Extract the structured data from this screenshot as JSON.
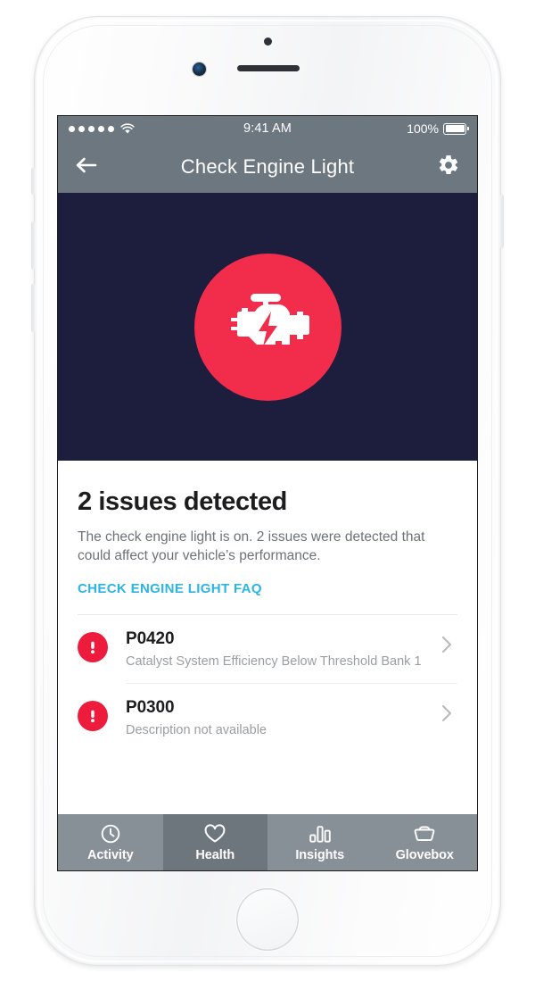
{
  "device": {
    "frame": "iphone-white",
    "hardware": {
      "camera": "front-camera",
      "speaker": "earpiece-speaker",
      "sensor": "proximity-sensor",
      "home_button": "home-button"
    }
  },
  "status_bar": {
    "signal_icon": "signal-dots-icon",
    "signal_bars_filled": 5,
    "wifi_icon": "wifi-icon",
    "time": "9:41 AM",
    "battery_percent": "100%",
    "battery_icon": "battery-full-icon"
  },
  "nav_bar": {
    "back_icon": "arrow-left-icon",
    "title": "Check Engine Light",
    "settings_icon": "gear-icon",
    "background_color": "#6d7780"
  },
  "hero": {
    "background_color": "#1d1d3e",
    "icon": "check-engine-light-icon",
    "icon_circle_color": "#f22c4b",
    "icon_glyph_color": "#ffffff"
  },
  "main": {
    "headline": "2 issues detected",
    "description": "The check engine light is on. 2 issues were detected that could affect your vehicle’s performance.",
    "faq_link": "CHECK ENGINE LIGHT FAQ",
    "faq_link_color": "#2bb4e4",
    "issues": [
      {
        "badge_icon": "alert-exclamation-icon",
        "badge_color": "#ee1c3c",
        "code": "P0420",
        "description": "Catalyst System Efficiency Below Threshold Bank 1",
        "chevron_icon": "chevron-right-icon"
      },
      {
        "badge_icon": "alert-exclamation-icon",
        "badge_color": "#ee1c3c",
        "code": "P0300",
        "description": "Description not available",
        "chevron_icon": "chevron-right-icon"
      }
    ]
  },
  "tab_bar": {
    "background_color": "#878f97",
    "active_color": "#6d757d",
    "active_index": 1,
    "tabs": [
      {
        "label": "Activity",
        "icon": "clock-icon"
      },
      {
        "label": "Health",
        "icon": "heart-icon"
      },
      {
        "label": "Insights",
        "icon": "bar-chart-icon"
      },
      {
        "label": "Glovebox",
        "icon": "glovebox-tray-icon"
      }
    ]
  }
}
